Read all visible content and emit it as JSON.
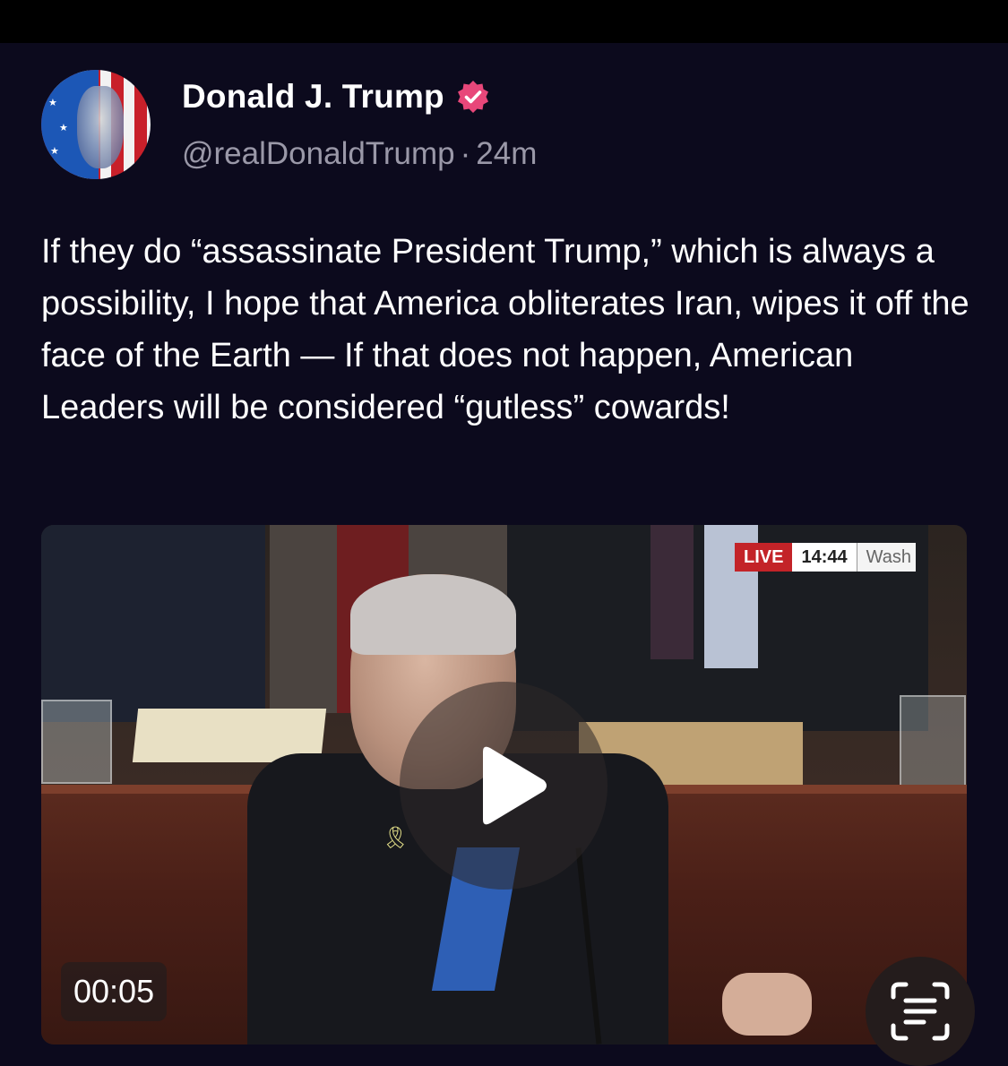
{
  "post": {
    "author_name": "Donald J. Trump",
    "handle": "@realDonaldTrump",
    "separator": "·",
    "time_ago": "24m",
    "text": "If they do “assassinate President Trump,” which is always a possibility, I hope that America obliterates Iran, wipes it off the face of the Earth — If that does not happen, American Leaders will be considered “gutless” cowards!"
  },
  "video": {
    "live_label": "LIVE",
    "live_time": "14:44",
    "live_location": "Wash",
    "duration": "00:05"
  },
  "colors": {
    "background": "#0c0a1d",
    "verified_badge": "#e8477a",
    "handle_text": "#9a98a8",
    "live_red": "#c32328"
  },
  "icons": {
    "verified": "verified-badge-icon",
    "play": "play-icon",
    "scan": "live-text-scan-icon"
  }
}
